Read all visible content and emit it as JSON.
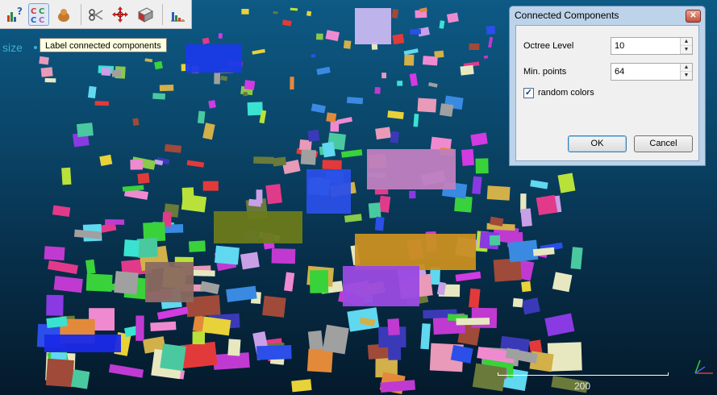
{
  "toolbar": {
    "buttons": [
      {
        "name": "histogram-help-icon"
      },
      {
        "name": "connected-components-icon",
        "label": "CC\nCC"
      },
      {
        "name": "sample-icon"
      },
      {
        "name": "scissors-icon"
      },
      {
        "name": "translate-icon"
      },
      {
        "name": "plane-icon"
      },
      {
        "name": "histogram-icon"
      }
    ]
  },
  "tooltip": "Label connected components",
  "size_label": "size",
  "dialog": {
    "title": "Connected Components",
    "octree_label": "Octree Level",
    "octree_value": "10",
    "min_points_label": "Min. points",
    "min_points_value": "64",
    "random_colors_label": "random colors",
    "random_colors_checked": true,
    "ok_label": "OK",
    "cancel_label": "Cancel"
  },
  "scale_bar": {
    "value": "200"
  },
  "colors": {
    "background_top": "#0d5a85",
    "background_bottom": "#041a2b",
    "dialog_frame": "#bcd3ea"
  }
}
